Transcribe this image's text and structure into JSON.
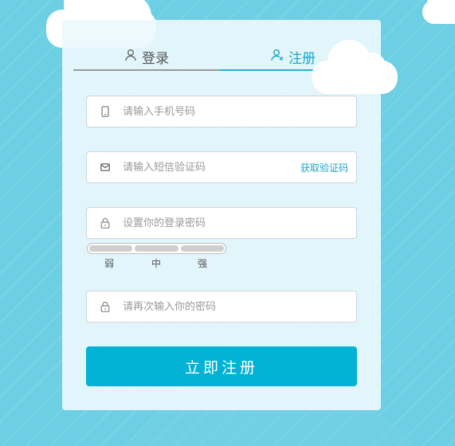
{
  "tabs": {
    "login_label": "登录",
    "register_label": "注册"
  },
  "form": {
    "phone_placeholder": "请输入手机号码",
    "sms_placeholder": "请输入短信验证码",
    "get_code_label": "获取验证码",
    "password_placeholder": "设置你的登录密码",
    "confirm_placeholder": "请再次输入你的密码",
    "submit_label": "立即注册"
  },
  "strength": {
    "weak": "弱",
    "medium": "中",
    "strong": "强"
  },
  "icons": {
    "login_tab": "user-icon",
    "register_tab": "user-add-icon",
    "phone": "mobile-phone-icon",
    "sms": "envelope-icon",
    "password": "lock-icon",
    "confirm": "lock-icon"
  },
  "colors": {
    "accent": "#02b2d5",
    "background": "#6ccfe3",
    "link": "#1aa7c9"
  }
}
